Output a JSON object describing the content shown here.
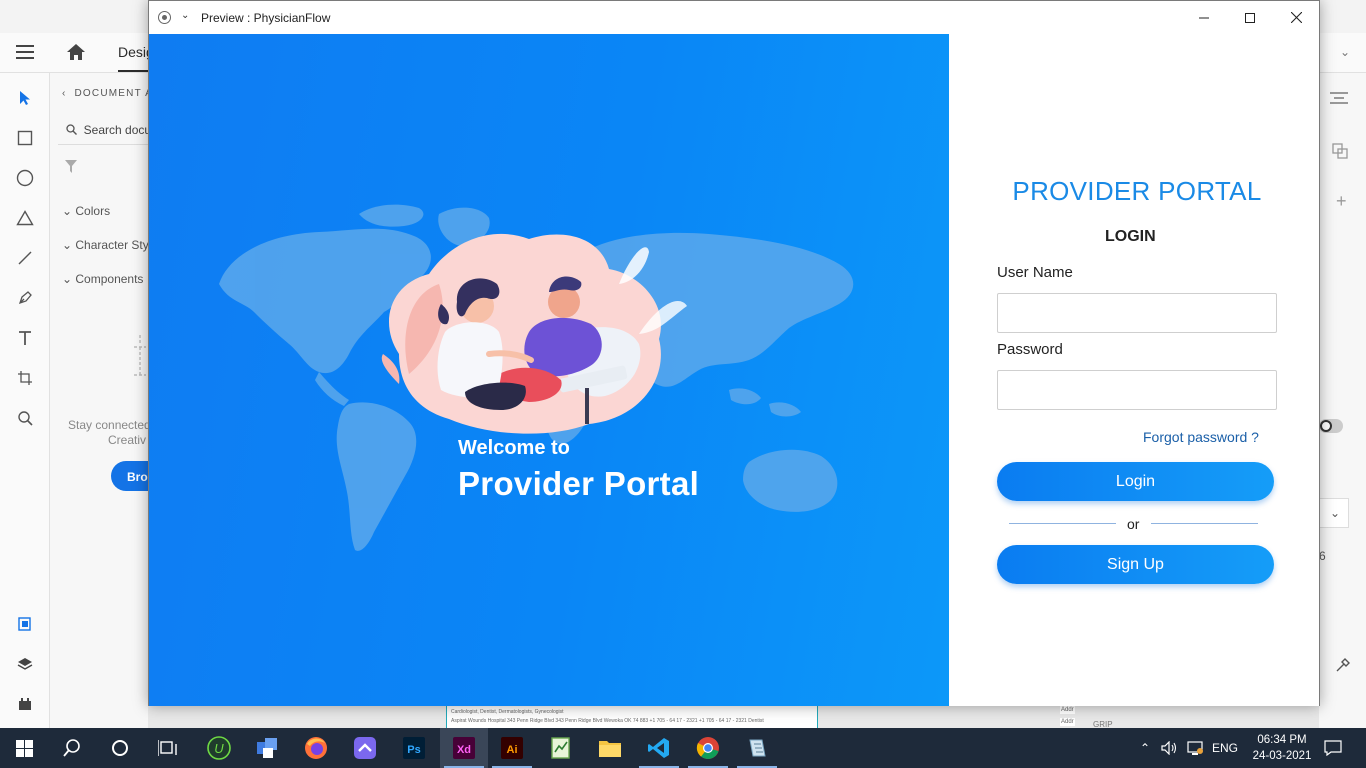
{
  "xd": {
    "design_tab": "Desig",
    "panel": {
      "document_assets": "DOCUMENT A",
      "search_placeholder": "Search docu",
      "sections": [
        "Colors",
        "Character Styl",
        "Components"
      ],
      "stay_connected": "Stay connected",
      "creative": "Creativ",
      "browse_button": "Bro"
    },
    "right_panel_number": "6",
    "bottom_doc_lines": [
      "Cardiologist, Dentist, Dermatologists, Gynecologist",
      "Aspirat Wounds Hospital   343 Penn Ridge Blvd   343 Penn Ridge Blvd   Wewoka   OK   74 883   +1 705 - 64 17 - 2321   +1 705 - 64 17 - 2321   Dentist"
    ],
    "bottom_right_labels": [
      "Addr",
      "Addr",
      "GRIP"
    ]
  },
  "window": {
    "title": "Preview : PhysicianFlow"
  },
  "hero": {
    "welcome": "Welcome to",
    "portal": "Provider Portal"
  },
  "login": {
    "title": "PROVIDER PORTAL",
    "heading": "LOGIN",
    "username_label": "User Name",
    "username_value": "",
    "password_label": "Password",
    "password_value": "",
    "forgot": "Forgot password ?",
    "login_button": "Login",
    "or": "or",
    "signup_button": "Sign Up",
    "accent": "#1a8ae6"
  },
  "taskbar": {
    "language": "ENG",
    "time": "06:34 PM",
    "date": "24-03-2021",
    "apps": [
      "start",
      "search",
      "cortana",
      "task-view",
      "upwork",
      "windows-tool",
      "firefox",
      "clickup",
      "photoshop",
      "adobe-xd",
      "illustrator",
      "notepad-app",
      "file-explorer",
      "vscode",
      "chrome",
      "editor-app"
    ]
  }
}
